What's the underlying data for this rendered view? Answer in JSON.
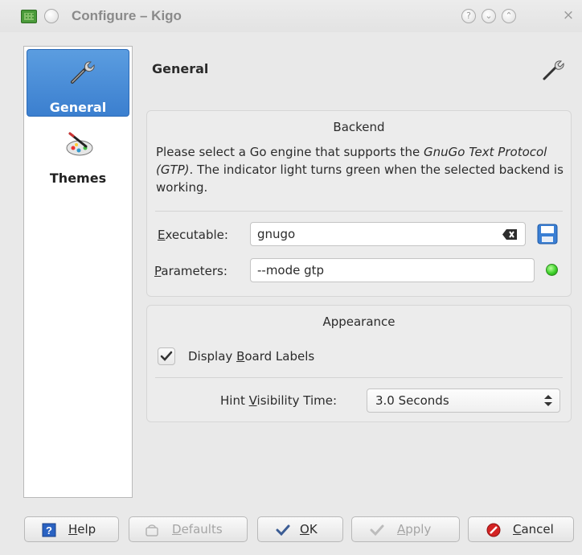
{
  "window": {
    "title": "Configure – Kigo",
    "help_glyph": "?",
    "minimize_glyph": "⌄",
    "maximize_glyph": "⌃",
    "close_glyph": "×"
  },
  "sidebar": {
    "items": [
      {
        "label": "General",
        "icon": "wrench-icon",
        "selected": true
      },
      {
        "label": "Themes",
        "icon": "palette-icon",
        "selected": false
      }
    ]
  },
  "page": {
    "title": "General",
    "icon": "wrench-icon"
  },
  "backend": {
    "title": "Backend",
    "description_pre": "Please select a Go engine that supports the ",
    "description_em": "GnuGo Text Protocol (GTP)",
    "description_post": ". The indicator light turns green when the selected backend is working.",
    "executable_label_accel": "E",
    "executable_label_rest": "xecutable:",
    "executable_value": "gnugo",
    "parameters_label_accel": "P",
    "parameters_label_rest": "arameters:",
    "parameters_value": "--mode gtp",
    "status_color": "#3ed12a"
  },
  "appearance": {
    "title": "Appearance",
    "board_labels_pre": "Display ",
    "board_labels_accel": "B",
    "board_labels_post": "oard Labels",
    "board_labels_checked": true,
    "hint_label_pre": "Hint ",
    "hint_label_accel": "V",
    "hint_label_post": "isibility Time:",
    "hint_value": "3.0 Seconds"
  },
  "buttons": {
    "help": {
      "accel": "H",
      "rest": "elp"
    },
    "defaults": {
      "accel": "D",
      "rest": "efaults"
    },
    "ok": {
      "accel": "O",
      "rest": "K"
    },
    "apply": {
      "accel": "A",
      "rest": "pply"
    },
    "cancel": {
      "accel": "C",
      "rest": "ancel"
    }
  },
  "colors": {
    "selection": "#3b7fcf",
    "background": "#e9e9e9"
  }
}
